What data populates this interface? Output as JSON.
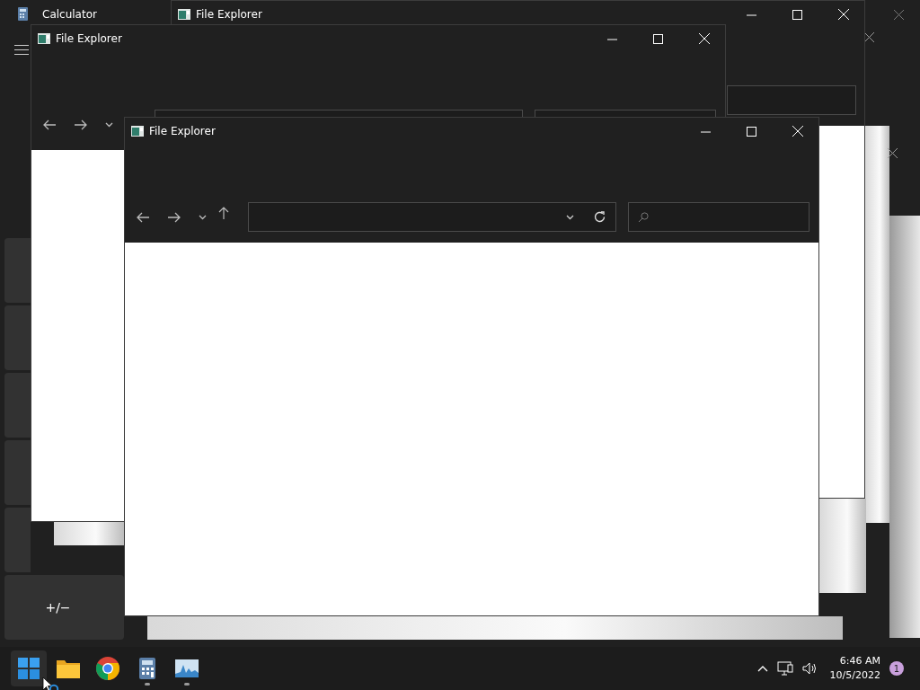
{
  "calculator": {
    "title": "Calculator",
    "sign_key": "+/−"
  },
  "windows": [
    {
      "kind": "back",
      "title": "File Explorer"
    },
    {
      "kind": "full",
      "title": "File Explorer"
    },
    {
      "kind": "full",
      "title": "File Explorer"
    }
  ],
  "taskbar": {
    "apps": [
      {
        "kind": "start",
        "running": false,
        "selected": true
      },
      {
        "kind": "folder",
        "running": false,
        "selected": false
      },
      {
        "kind": "browser",
        "running": false,
        "selected": false
      },
      {
        "kind": "calculator",
        "running": true,
        "selected": false
      },
      {
        "kind": "monitor",
        "running": true,
        "selected": false
      }
    ],
    "time": "6:46 AM",
    "date": "10/5/2022",
    "notification_count": "1"
  }
}
